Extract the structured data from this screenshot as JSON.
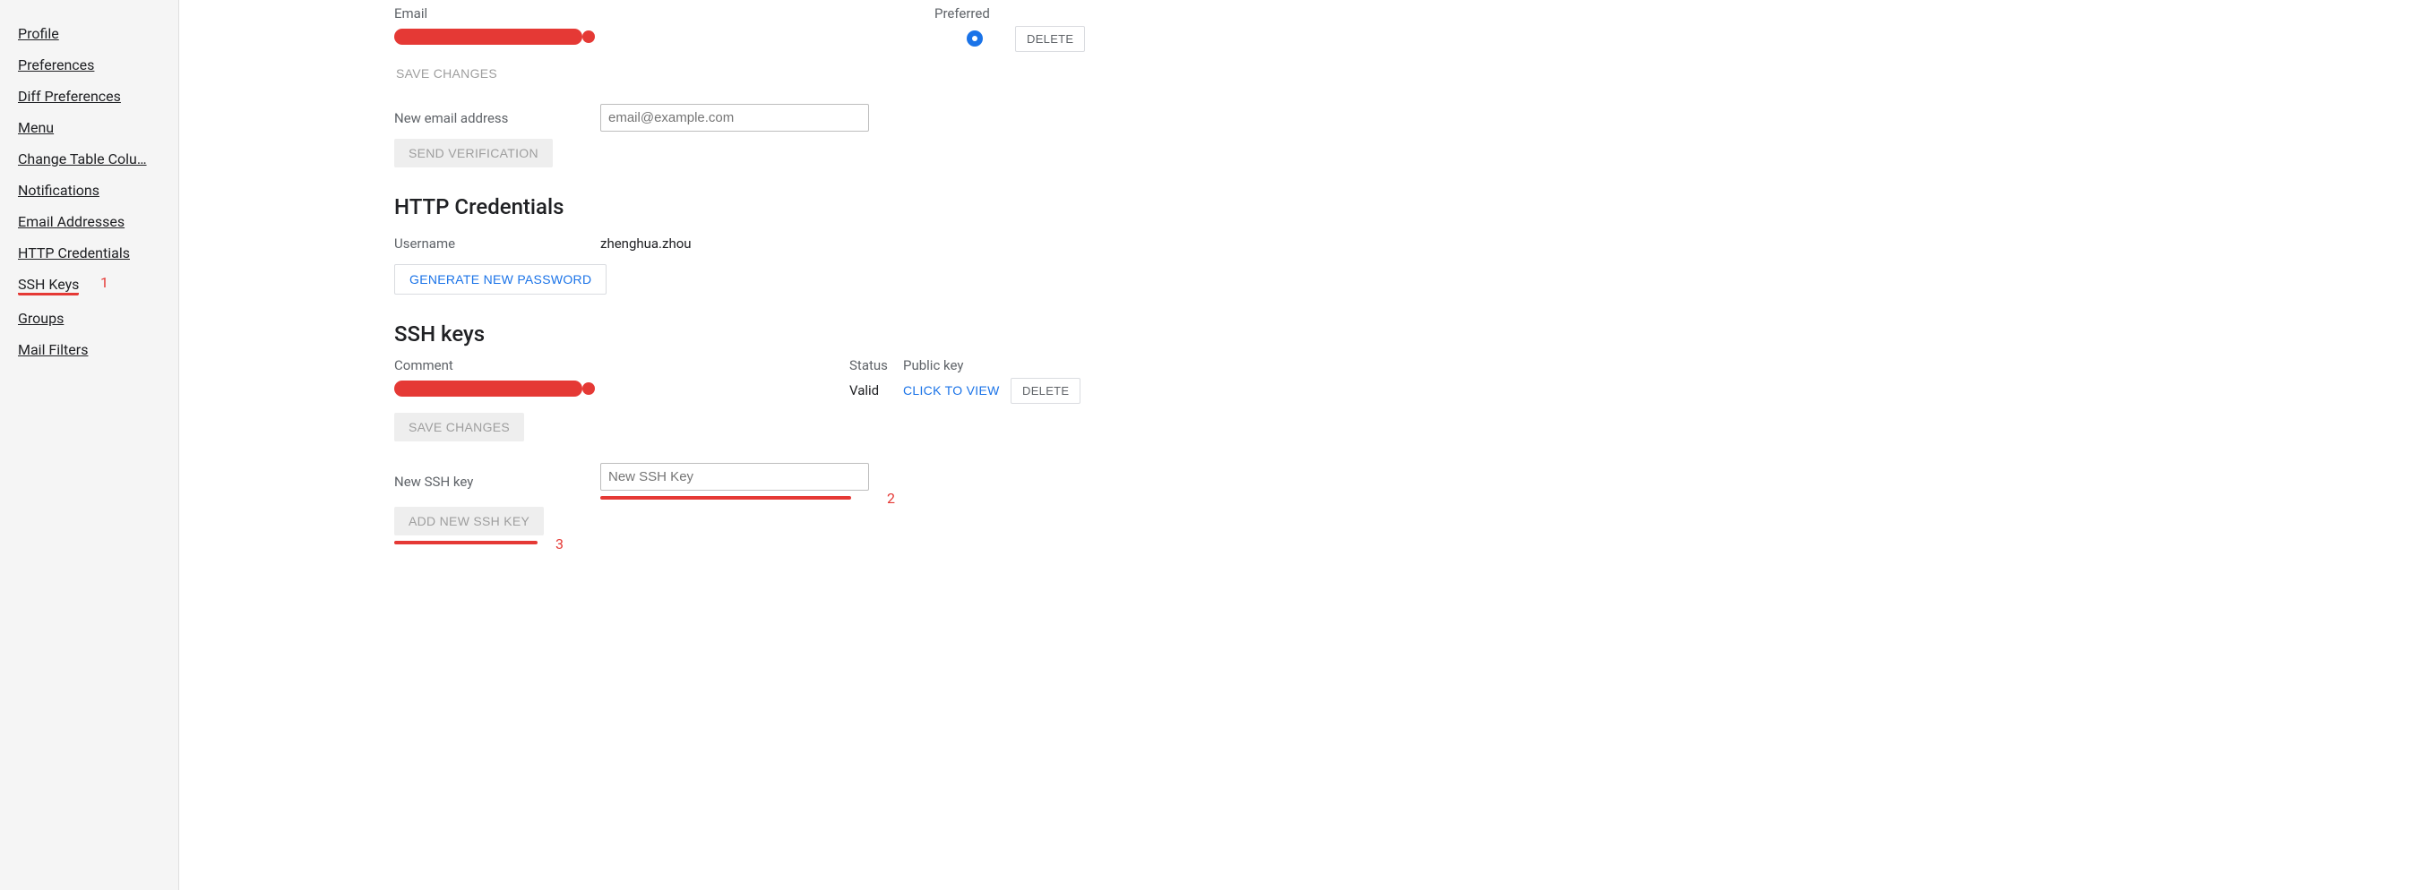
{
  "sidebar": {
    "items": [
      "Profile",
      "Preferences",
      "Diff Preferences",
      "Menu",
      "Change Table Colu…",
      "Notifications",
      "Email Addresses",
      "HTTP Credentials",
      "SSH Keys",
      "Groups",
      "Mail Filters"
    ]
  },
  "email_section": {
    "header_email": "Email",
    "header_preferred": "Preferred",
    "delete_label": "DELETE",
    "save_changes_label": "SAVE CHANGES",
    "new_email_label": "New email address",
    "new_email_placeholder": "email@example.com",
    "send_verification_label": "SEND VERIFICATION"
  },
  "http_cred_section": {
    "heading": "HTTP Credentials",
    "username_label": "Username",
    "username_value": "zhenghua.zhou",
    "generate_pw_label": "GENERATE NEW PASSWORD"
  },
  "ssh_section": {
    "heading": "SSH keys",
    "col_comment": "Comment",
    "col_status": "Status",
    "col_pubkey": "Public key",
    "status_value": "Valid",
    "view_label": "CLICK TO VIEW",
    "delete_label": "DELETE",
    "save_changes_label": "SAVE CHANGES",
    "new_key_label": "New SSH key",
    "new_key_placeholder": "New SSH Key",
    "add_key_label": "ADD NEW SSH KEY"
  },
  "annotations": {
    "a1": "1",
    "a2": "2",
    "a3": "3"
  }
}
